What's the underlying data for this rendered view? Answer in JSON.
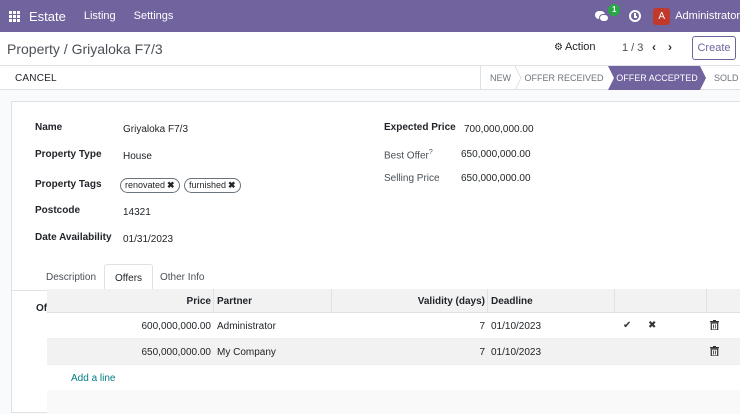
{
  "navbar": {
    "brand": "Estate",
    "menu": [
      "Listing",
      "Settings"
    ],
    "message_count": "1",
    "user_initial": "A",
    "user_name": "Administrator"
  },
  "control_panel": {
    "breadcrumb": "Property / Griyaloka F7/3",
    "action_label": "Action",
    "pager": "1 / 3",
    "create_label": "Create"
  },
  "status_bar": {
    "cancel_label": "CANCEL",
    "stages": [
      "NEW",
      "OFFER RECEIVED",
      "OFFER ACCEPTED",
      "SOLD"
    ],
    "active_stage": "OFFER ACCEPTED"
  },
  "form": {
    "left": [
      {
        "label": "Name",
        "value": "Griyaloka F7/3"
      },
      {
        "label": "Property Type",
        "value": "House"
      },
      {
        "label": "Property Tags",
        "tags": [
          "renovated",
          "furnished"
        ]
      },
      {
        "label": "Postcode",
        "value": "14321"
      },
      {
        "label": "Date Availability",
        "value": "01/31/2023"
      }
    ],
    "right": [
      {
        "label": "Expected Price",
        "value": "700,000,000.00"
      },
      {
        "label": "Best Offer",
        "sup": "?",
        "value": "650,000,000.00"
      },
      {
        "label": "Selling Price",
        "value": "650,000,000.00"
      }
    ]
  },
  "tabs": [
    "Description",
    "Offers",
    "Other Info"
  ],
  "active_tab": "Offers",
  "offers": {
    "section_label": "Of",
    "columns": [
      "Price",
      "Partner",
      "Validity (days)",
      "Deadline"
    ],
    "rows": [
      {
        "price": "600,000,000.00",
        "partner": "Administrator",
        "validity": "7",
        "deadline": "01/10/2023"
      },
      {
        "price": "650,000,000.00",
        "partner": "My Company",
        "validity": "7",
        "deadline": "01/10/2023"
      }
    ],
    "add_line": "Add a line"
  }
}
